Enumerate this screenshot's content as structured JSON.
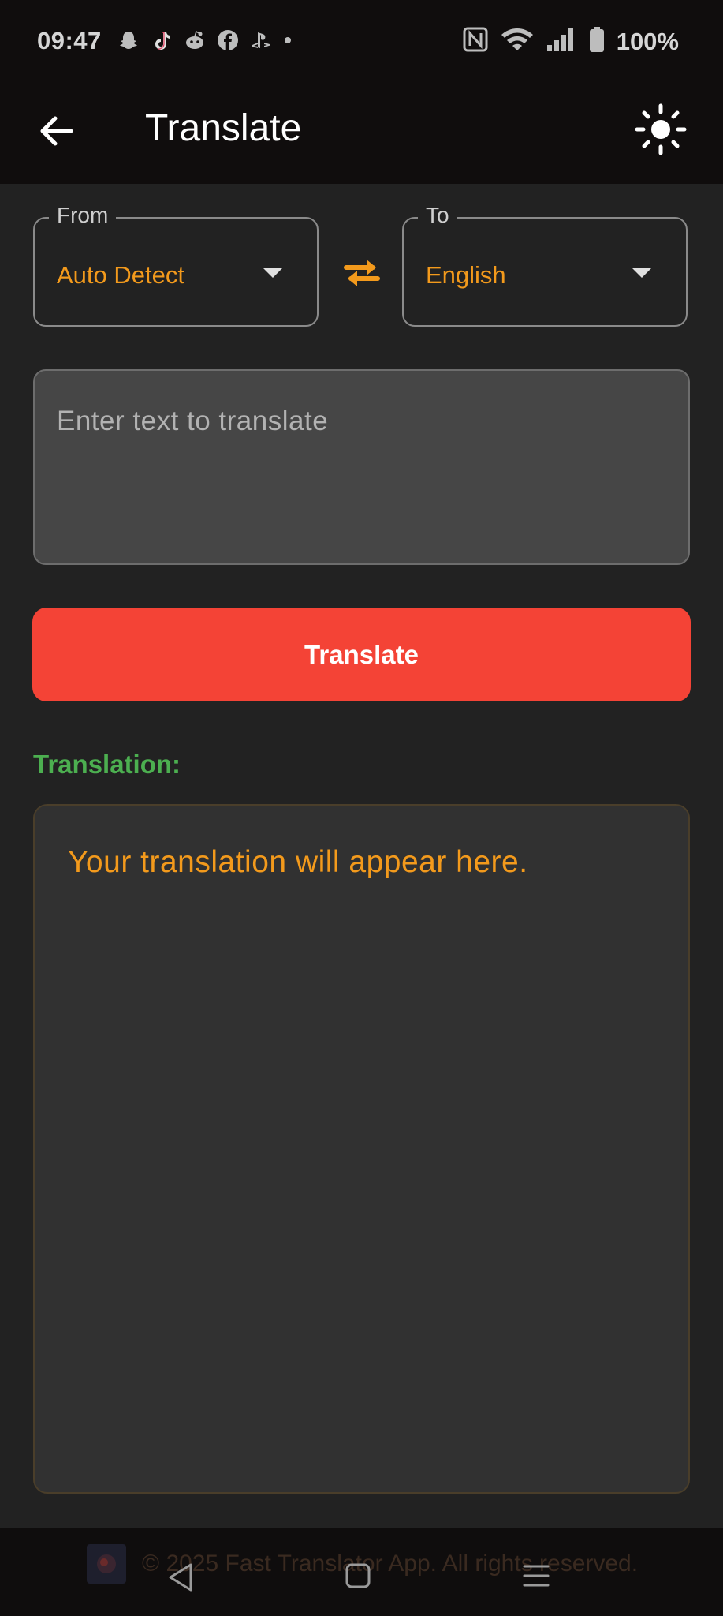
{
  "status_bar": {
    "time": "09:47",
    "battery": "100%",
    "left_icons": [
      "snapchat-icon",
      "tiktok-icon",
      "reddit-icon",
      "facebook-icon",
      "playstation-icon",
      "dot-icon"
    ],
    "right_icons": [
      "nfc-icon",
      "wifi-icon",
      "signal-icon",
      "battery-icon"
    ]
  },
  "app_bar": {
    "title": "Translate",
    "back_icon": "arrow-left-icon",
    "theme_icon": "sun-icon"
  },
  "languages": {
    "from_label": "From",
    "from_value": "Auto Detect",
    "to_label": "To",
    "to_value": "English",
    "swap_icon": "swap-arrows-icon"
  },
  "input": {
    "placeholder": "Enter text to translate",
    "value": ""
  },
  "translate_button": {
    "label": "Translate"
  },
  "result": {
    "label": "Translation:",
    "placeholder_text": "Your translation will appear here."
  },
  "footer": {
    "text": "© 2025 Fast Translator App. All rights reserved."
  },
  "colors": {
    "accent_orange": "#f39a1c",
    "button_red": "#f44336",
    "label_green": "#4caf50",
    "background": "#222222",
    "bar": "#100d0d"
  }
}
